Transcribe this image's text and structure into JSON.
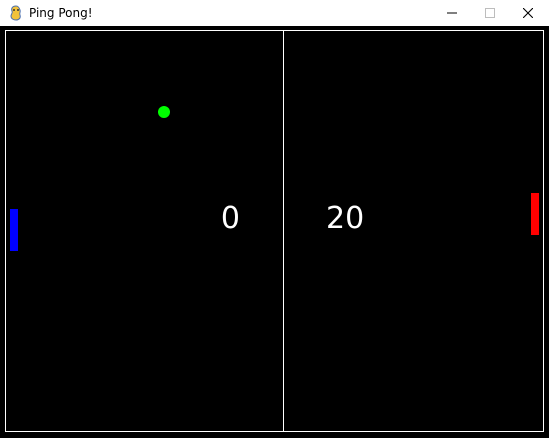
{
  "window": {
    "title": "Ping Pong!",
    "icon": "pygame-snake-icon",
    "controls": {
      "minimize_icon": "minimize-icon",
      "maximize_icon": "maximize-icon",
      "close_icon": "close-icon"
    }
  },
  "game": {
    "background_color": "#000000",
    "line_color": "#ffffff",
    "score_left": "0",
    "score_right": "20",
    "left_paddle_color": "#0000ff",
    "right_paddle_color": "#ff0000",
    "ball_color": "#00ff00"
  }
}
